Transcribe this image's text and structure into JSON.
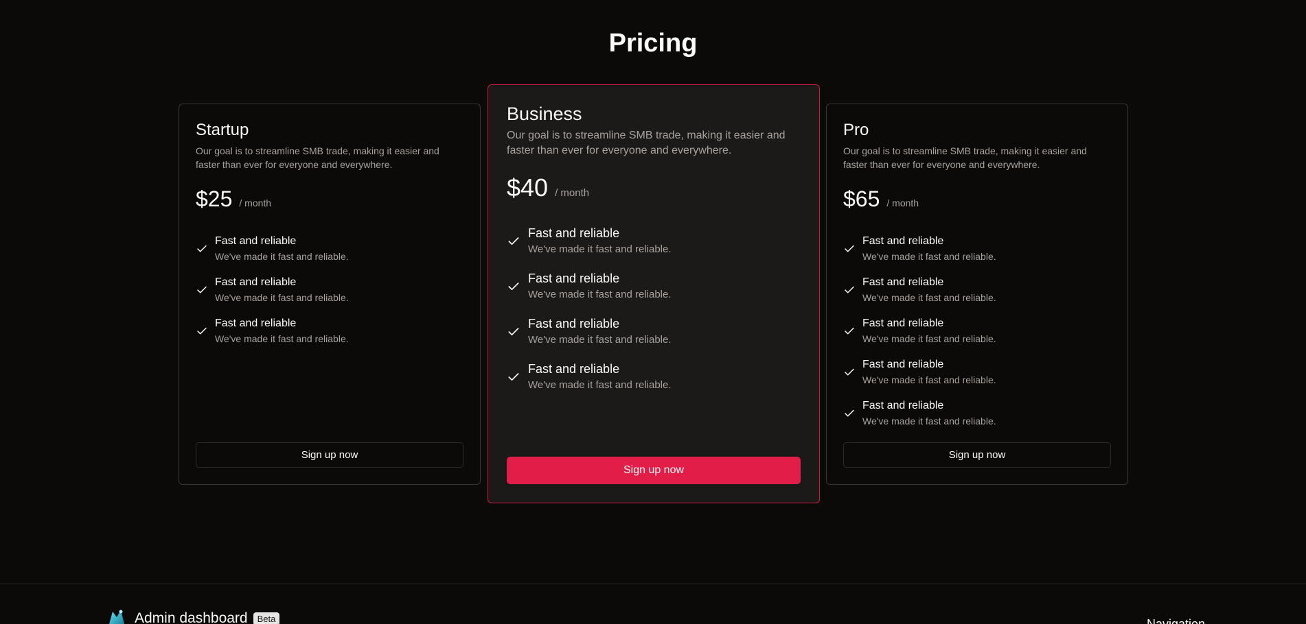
{
  "page": {
    "title": "Pricing"
  },
  "plans": [
    {
      "name": "Startup",
      "description": "Our goal is to streamline SMB trade, making it easier and faster than ever for everyone and everywhere.",
      "price": "$25",
      "period": "/ month",
      "features": [
        {
          "title": "Fast and reliable",
          "subtitle": "We've made it fast and reliable."
        },
        {
          "title": "Fast and reliable",
          "subtitle": "We've made it fast and reliable."
        },
        {
          "title": "Fast and reliable",
          "subtitle": "We've made it fast and reliable."
        }
      ],
      "cta": "Sign up now",
      "highlighted": false
    },
    {
      "name": "Business",
      "description": "Our goal is to streamline SMB trade, making it easier and faster than ever for everyone and everywhere.",
      "price": "$40",
      "period": "/ month",
      "features": [
        {
          "title": "Fast and reliable",
          "subtitle": "We've made it fast and reliable."
        },
        {
          "title": "Fast and reliable",
          "subtitle": "We've made it fast and reliable."
        },
        {
          "title": "Fast and reliable",
          "subtitle": "We've made it fast and reliable."
        },
        {
          "title": "Fast and reliable",
          "subtitle": "We've made it fast and reliable."
        }
      ],
      "cta": "Sign up now",
      "highlighted": true
    },
    {
      "name": "Pro",
      "description": "Our goal is to streamline SMB trade, making it easier and faster than ever for everyone and everywhere.",
      "price": "$65",
      "period": "/ month",
      "features": [
        {
          "title": "Fast and reliable",
          "subtitle": "We've made it fast and reliable."
        },
        {
          "title": "Fast and reliable",
          "subtitle": "We've made it fast and reliable."
        },
        {
          "title": "Fast and reliable",
          "subtitle": "We've made it fast and reliable."
        },
        {
          "title": "Fast and reliable",
          "subtitle": "We've made it fast and reliable."
        },
        {
          "title": "Fast and reliable",
          "subtitle": "We've made it fast and reliable."
        }
      ],
      "cta": "Sign up now",
      "highlighted": false
    }
  ],
  "footer": {
    "brand_name": "Admin dashboard",
    "badge": "Beta",
    "nav_heading": "Navigation",
    "logo_icon": "logo-icon"
  },
  "colors": {
    "background": "#0c0a09",
    "accent": "#e11d48",
    "highlight_border": "#d11a45",
    "muted_text": "#a8a29e"
  }
}
